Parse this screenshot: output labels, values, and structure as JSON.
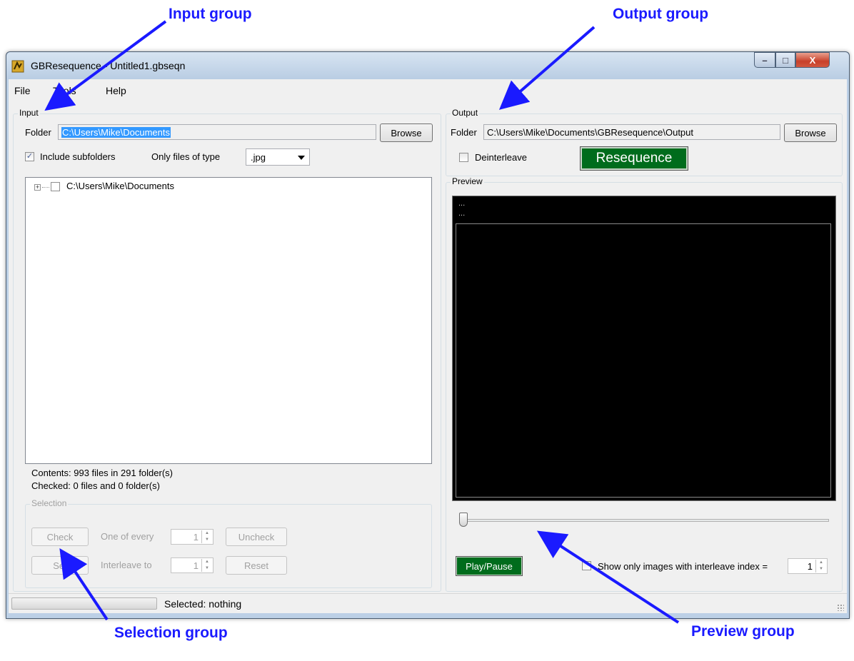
{
  "annotations": {
    "input_group": "Input group",
    "output_group": "Output group",
    "selection_group": "Selection group",
    "preview_group": "Preview group"
  },
  "window": {
    "title": "GBResequence - Untitled1.gbseqn",
    "minimize_glyph": "–",
    "maximize_glyph": "□",
    "close_glyph": "X"
  },
  "menu": [
    "File",
    "Tools",
    "Help"
  ],
  "input": {
    "legend": "Input",
    "folder_label": "Folder",
    "folder_value": "C:\\Users\\Mike\\Documents",
    "browse_label": "Browse",
    "include_subfolders_label": "Include subfolders",
    "include_subfolders_checked": true,
    "only_files_label": "Only files of type",
    "file_type_value": ".jpg",
    "tree_root": "C:\\Users\\Mike\\Documents",
    "contents": "Contents: 993 files in 291 folder(s)",
    "checked": "Checked: 0 files and 0 folder(s)"
  },
  "selection": {
    "legend": "Selection",
    "check_label": "Check",
    "one_of_every_label": "One of every",
    "one_of_every_value": "1",
    "uncheck_label": "Uncheck",
    "set_label": "Set",
    "interleave_to_label": "Interleave to",
    "interleave_to_value": "1",
    "reset_label": "Reset"
  },
  "output": {
    "legend": "Output",
    "folder_label": "Folder",
    "folder_value": "C:\\Users\\Mike\\Documents\\GBResequence\\Output",
    "browse_label": "Browse",
    "deinterleave_label": "Deinterleave",
    "deinterleave_checked": false,
    "resequence_label": "Resequence"
  },
  "preview": {
    "legend": "Preview",
    "line1": "...",
    "line2": "...",
    "slider_position": 0,
    "play_pause_label": "Play/Pause",
    "show_only_label": "Show only  images with interleave index =",
    "interleave_index_value": "1",
    "show_only_checked": false
  },
  "status": {
    "progress": 0,
    "text": "Selected: nothing"
  },
  "colors": {
    "annotation": "#1a1aff",
    "selection_highlight": "#3399ff",
    "resequence_bg": "#006c1c",
    "preview_bg": "#000000"
  }
}
